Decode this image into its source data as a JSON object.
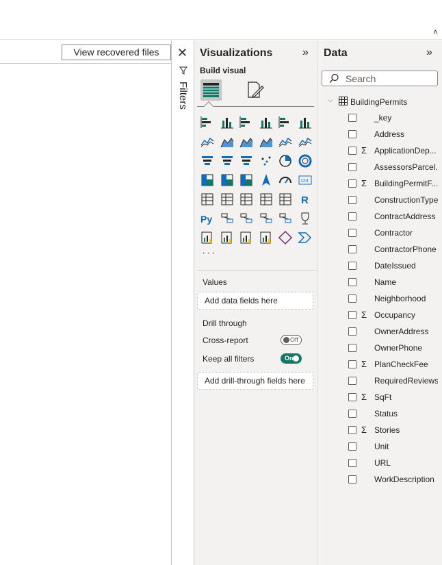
{
  "ribbon": {
    "collapse_icon": "chevron-up-icon"
  },
  "canvas": {
    "recover_button_label": "View recovered files",
    "close_icon": "close-icon"
  },
  "filters": {
    "label": "Filters"
  },
  "visualizations": {
    "title": "Visualizations",
    "build_visual_label": "Build visual",
    "more_label": "···",
    "wells": {
      "values_label": "Values",
      "values_placeholder": "Add data fields here",
      "drill_through_label": "Drill through",
      "cross_report_label": "Cross-report",
      "cross_report_state": "Off",
      "keep_filters_label": "Keep all filters",
      "keep_filters_state": "On",
      "drill_placeholder": "Add drill-through fields here"
    },
    "accent": "#117865"
  },
  "data": {
    "title": "Data",
    "search_placeholder": "Search",
    "table_name": "BuildingPermits",
    "fields": [
      {
        "name": "_key",
        "sum": false
      },
      {
        "name": "Address",
        "sum": false
      },
      {
        "name": "ApplicationDep...",
        "sum": true
      },
      {
        "name": "AssessorsParcel...",
        "sum": false
      },
      {
        "name": "BuildingPermitF...",
        "sum": true
      },
      {
        "name": "ConstructionType",
        "sum": false
      },
      {
        "name": "ContractAddress",
        "sum": false
      },
      {
        "name": "Contractor",
        "sum": false
      },
      {
        "name": "ContractorPhone",
        "sum": false
      },
      {
        "name": "DateIssued",
        "sum": false
      },
      {
        "name": "Name",
        "sum": false
      },
      {
        "name": "Neighborhood",
        "sum": false
      },
      {
        "name": "Occupancy",
        "sum": true
      },
      {
        "name": "OwnerAddress",
        "sum": false
      },
      {
        "name": "OwnerPhone",
        "sum": false
      },
      {
        "name": "PlanCheckFee",
        "sum": true
      },
      {
        "name": "RequiredReviews",
        "sum": false
      },
      {
        "name": "SqFt",
        "sum": true
      },
      {
        "name": "Status",
        "sum": false
      },
      {
        "name": "Stories",
        "sum": true
      },
      {
        "name": "Unit",
        "sum": false
      },
      {
        "name": "URL",
        "sum": false
      },
      {
        "name": "WorkDescription",
        "sum": false
      }
    ],
    "sigma_glyph": "Σ"
  }
}
